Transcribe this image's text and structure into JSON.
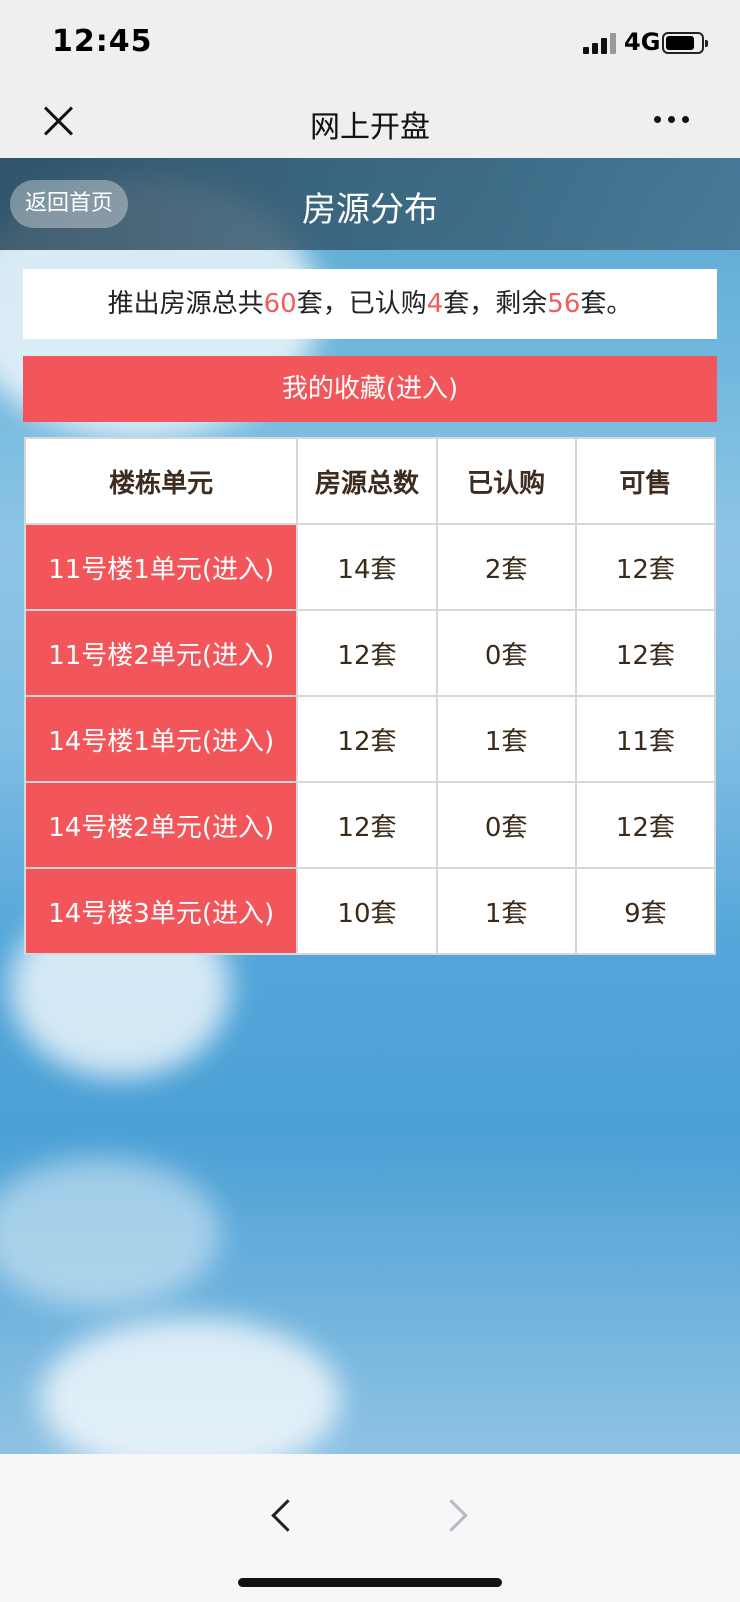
{
  "status": {
    "time": "12:45",
    "network": "4G"
  },
  "nav": {
    "title": "网上开盘"
  },
  "header": {
    "back_label": "返回首页",
    "page_title": "房源分布"
  },
  "summary": {
    "prefix": "推出房源总共",
    "total": "60",
    "mid1": "套，已认购",
    "subscribed": "4",
    "mid2": "套，剩余",
    "remaining": "56",
    "suffix": "套。"
  },
  "favorites": {
    "label": "我的收藏(进入)"
  },
  "table": {
    "headers": [
      "楼栋单元",
      "房源总数",
      "已认购",
      "可售"
    ],
    "rows": [
      {
        "unit": "11号楼1单元(进入)",
        "total": "14套",
        "subscribed": "2套",
        "available": "12套"
      },
      {
        "unit": "11号楼2单元(进入)",
        "total": "12套",
        "subscribed": "0套",
        "available": "12套"
      },
      {
        "unit": "14号楼1单元(进入)",
        "total": "12套",
        "subscribed": "1套",
        "available": "11套"
      },
      {
        "unit": "14号楼2单元(进入)",
        "total": "12套",
        "subscribed": "0套",
        "available": "12套"
      },
      {
        "unit": "14号楼3单元(进入)",
        "total": "10套",
        "subscribed": "1套",
        "available": "9套"
      }
    ]
  },
  "colors": {
    "accent": "#f2565a",
    "highlight": "#ef5d5d"
  },
  "icons": {
    "close": "close-icon",
    "more": "more-icon",
    "back": "chevron-left-icon",
    "forward": "chevron-right-icon"
  }
}
